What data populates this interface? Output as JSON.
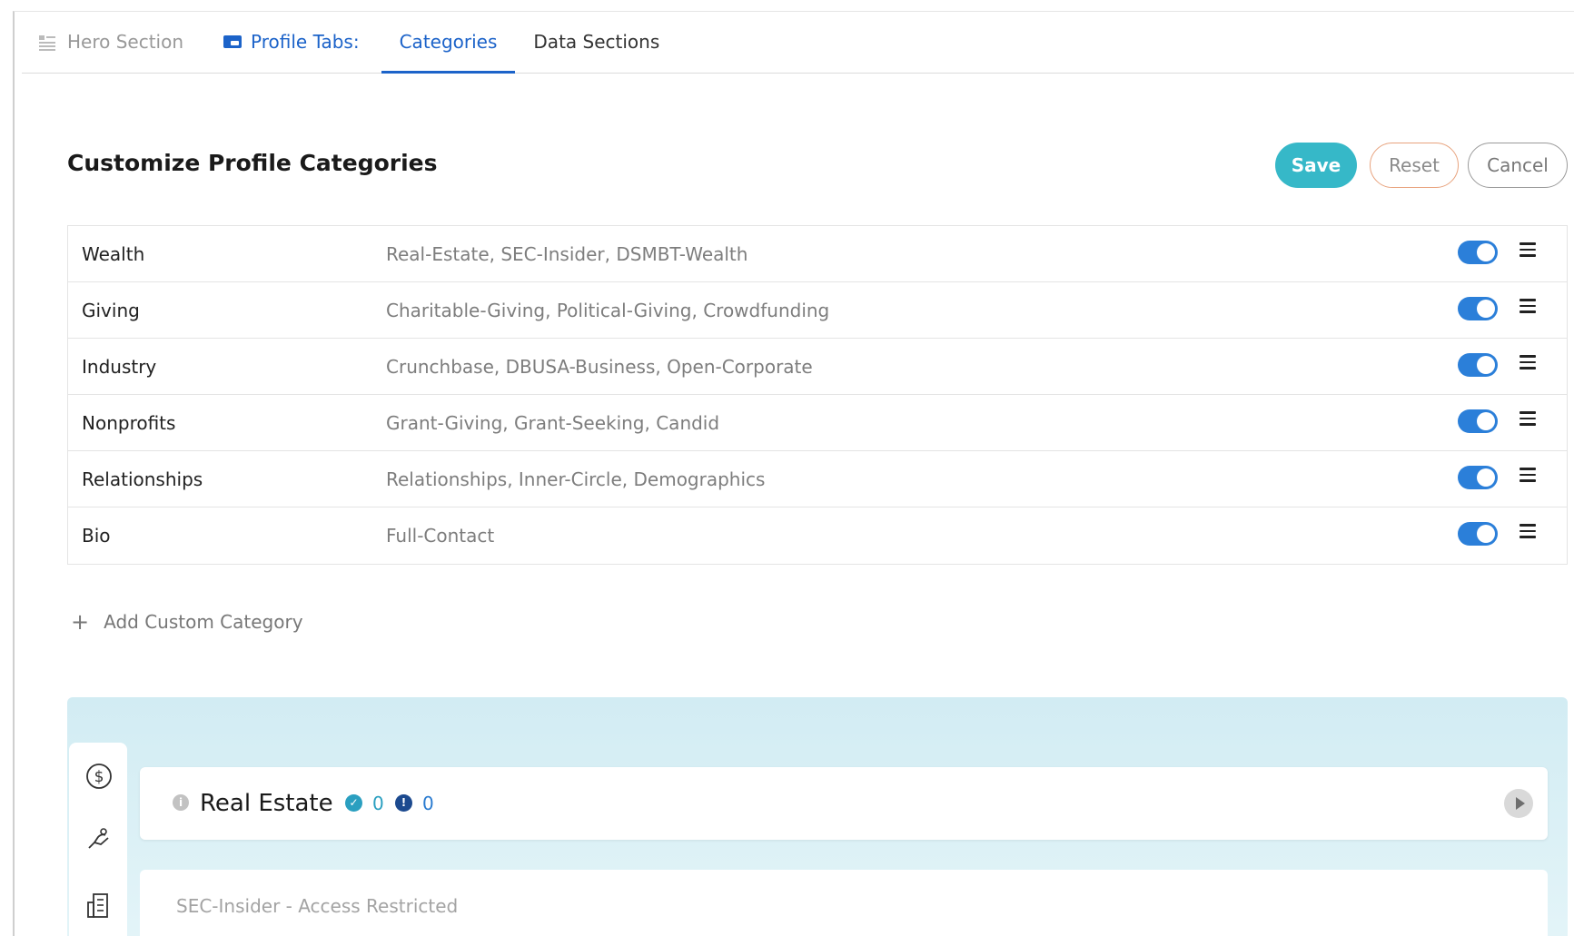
{
  "tabs": {
    "hero": "Hero Section",
    "profile": "Profile Tabs:",
    "categories": "Categories",
    "data_sections": "Data Sections"
  },
  "header": {
    "title": "Customize Profile Categories",
    "save_label": "Save",
    "reset_label": "Reset",
    "cancel_label": "Cancel"
  },
  "categories": [
    {
      "name": "Wealth",
      "sources": "Real-Estate, SEC-Insider, DSMBT-Wealth",
      "enabled": true
    },
    {
      "name": "Giving",
      "sources": "Charitable-Giving, Political-Giving, Crowdfunding",
      "enabled": true
    },
    {
      "name": "Industry",
      "sources": "Crunchbase, DBUSA-Business, Open-Corporate",
      "enabled": true
    },
    {
      "name": "Nonprofits",
      "sources": "Grant-Giving, Grant-Seeking, Candid",
      "enabled": true
    },
    {
      "name": "Relationships",
      "sources": "Relationships, Inner-Circle, Demographics",
      "enabled": true
    },
    {
      "name": "Bio",
      "sources": "Full-Contact",
      "enabled": true
    }
  ],
  "add_custom_label": "Add Custom Category",
  "preview": {
    "card_title": "Real Estate",
    "verified_count": "0",
    "alert_count": "0",
    "restricted_text": "SEC-Insider - Access Restricted"
  },
  "colors": {
    "accent": "#1c63c9",
    "save": "#36b8c8",
    "toggle_on": "#2b7fd9",
    "preview_bg": "#d2ecf3"
  }
}
